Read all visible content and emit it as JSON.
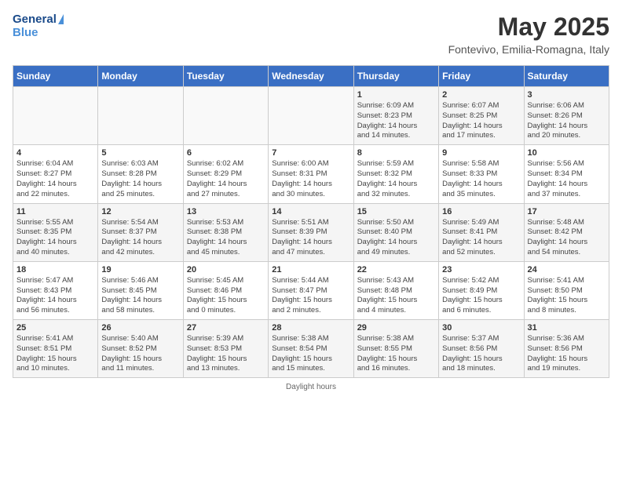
{
  "header": {
    "logo_general": "General",
    "logo_blue": "Blue",
    "title": "May 2025",
    "subtitle": "Fontevivo, Emilia-Romagna, Italy"
  },
  "days_of_week": [
    "Sunday",
    "Monday",
    "Tuesday",
    "Wednesday",
    "Thursday",
    "Friday",
    "Saturday"
  ],
  "weeks": [
    [
      {
        "day": "",
        "info": ""
      },
      {
        "day": "",
        "info": ""
      },
      {
        "day": "",
        "info": ""
      },
      {
        "day": "",
        "info": ""
      },
      {
        "day": "1",
        "info": "Sunrise: 6:09 AM\nSunset: 8:23 PM\nDaylight: 14 hours\nand 14 minutes."
      },
      {
        "day": "2",
        "info": "Sunrise: 6:07 AM\nSunset: 8:25 PM\nDaylight: 14 hours\nand 17 minutes."
      },
      {
        "day": "3",
        "info": "Sunrise: 6:06 AM\nSunset: 8:26 PM\nDaylight: 14 hours\nand 20 minutes."
      }
    ],
    [
      {
        "day": "4",
        "info": "Sunrise: 6:04 AM\nSunset: 8:27 PM\nDaylight: 14 hours\nand 22 minutes."
      },
      {
        "day": "5",
        "info": "Sunrise: 6:03 AM\nSunset: 8:28 PM\nDaylight: 14 hours\nand 25 minutes."
      },
      {
        "day": "6",
        "info": "Sunrise: 6:02 AM\nSunset: 8:29 PM\nDaylight: 14 hours\nand 27 minutes."
      },
      {
        "day": "7",
        "info": "Sunrise: 6:00 AM\nSunset: 8:31 PM\nDaylight: 14 hours\nand 30 minutes."
      },
      {
        "day": "8",
        "info": "Sunrise: 5:59 AM\nSunset: 8:32 PM\nDaylight: 14 hours\nand 32 minutes."
      },
      {
        "day": "9",
        "info": "Sunrise: 5:58 AM\nSunset: 8:33 PM\nDaylight: 14 hours\nand 35 minutes."
      },
      {
        "day": "10",
        "info": "Sunrise: 5:56 AM\nSunset: 8:34 PM\nDaylight: 14 hours\nand 37 minutes."
      }
    ],
    [
      {
        "day": "11",
        "info": "Sunrise: 5:55 AM\nSunset: 8:35 PM\nDaylight: 14 hours\nand 40 minutes."
      },
      {
        "day": "12",
        "info": "Sunrise: 5:54 AM\nSunset: 8:37 PM\nDaylight: 14 hours\nand 42 minutes."
      },
      {
        "day": "13",
        "info": "Sunrise: 5:53 AM\nSunset: 8:38 PM\nDaylight: 14 hours\nand 45 minutes."
      },
      {
        "day": "14",
        "info": "Sunrise: 5:51 AM\nSunset: 8:39 PM\nDaylight: 14 hours\nand 47 minutes."
      },
      {
        "day": "15",
        "info": "Sunrise: 5:50 AM\nSunset: 8:40 PM\nDaylight: 14 hours\nand 49 minutes."
      },
      {
        "day": "16",
        "info": "Sunrise: 5:49 AM\nSunset: 8:41 PM\nDaylight: 14 hours\nand 52 minutes."
      },
      {
        "day": "17",
        "info": "Sunrise: 5:48 AM\nSunset: 8:42 PM\nDaylight: 14 hours\nand 54 minutes."
      }
    ],
    [
      {
        "day": "18",
        "info": "Sunrise: 5:47 AM\nSunset: 8:43 PM\nDaylight: 14 hours\nand 56 minutes."
      },
      {
        "day": "19",
        "info": "Sunrise: 5:46 AM\nSunset: 8:45 PM\nDaylight: 14 hours\nand 58 minutes."
      },
      {
        "day": "20",
        "info": "Sunrise: 5:45 AM\nSunset: 8:46 PM\nDaylight: 15 hours\nand 0 minutes."
      },
      {
        "day": "21",
        "info": "Sunrise: 5:44 AM\nSunset: 8:47 PM\nDaylight: 15 hours\nand 2 minutes."
      },
      {
        "day": "22",
        "info": "Sunrise: 5:43 AM\nSunset: 8:48 PM\nDaylight: 15 hours\nand 4 minutes."
      },
      {
        "day": "23",
        "info": "Sunrise: 5:42 AM\nSunset: 8:49 PM\nDaylight: 15 hours\nand 6 minutes."
      },
      {
        "day": "24",
        "info": "Sunrise: 5:41 AM\nSunset: 8:50 PM\nDaylight: 15 hours\nand 8 minutes."
      }
    ],
    [
      {
        "day": "25",
        "info": "Sunrise: 5:41 AM\nSunset: 8:51 PM\nDaylight: 15 hours\nand 10 minutes."
      },
      {
        "day": "26",
        "info": "Sunrise: 5:40 AM\nSunset: 8:52 PM\nDaylight: 15 hours\nand 11 minutes."
      },
      {
        "day": "27",
        "info": "Sunrise: 5:39 AM\nSunset: 8:53 PM\nDaylight: 15 hours\nand 13 minutes."
      },
      {
        "day": "28",
        "info": "Sunrise: 5:38 AM\nSunset: 8:54 PM\nDaylight: 15 hours\nand 15 minutes."
      },
      {
        "day": "29",
        "info": "Sunrise: 5:38 AM\nSunset: 8:55 PM\nDaylight: 15 hours\nand 16 minutes."
      },
      {
        "day": "30",
        "info": "Sunrise: 5:37 AM\nSunset: 8:56 PM\nDaylight: 15 hours\nand 18 minutes."
      },
      {
        "day": "31",
        "info": "Sunrise: 5:36 AM\nSunset: 8:56 PM\nDaylight: 15 hours\nand 19 minutes."
      }
    ]
  ],
  "footer": {
    "text": "Daylight hours"
  }
}
